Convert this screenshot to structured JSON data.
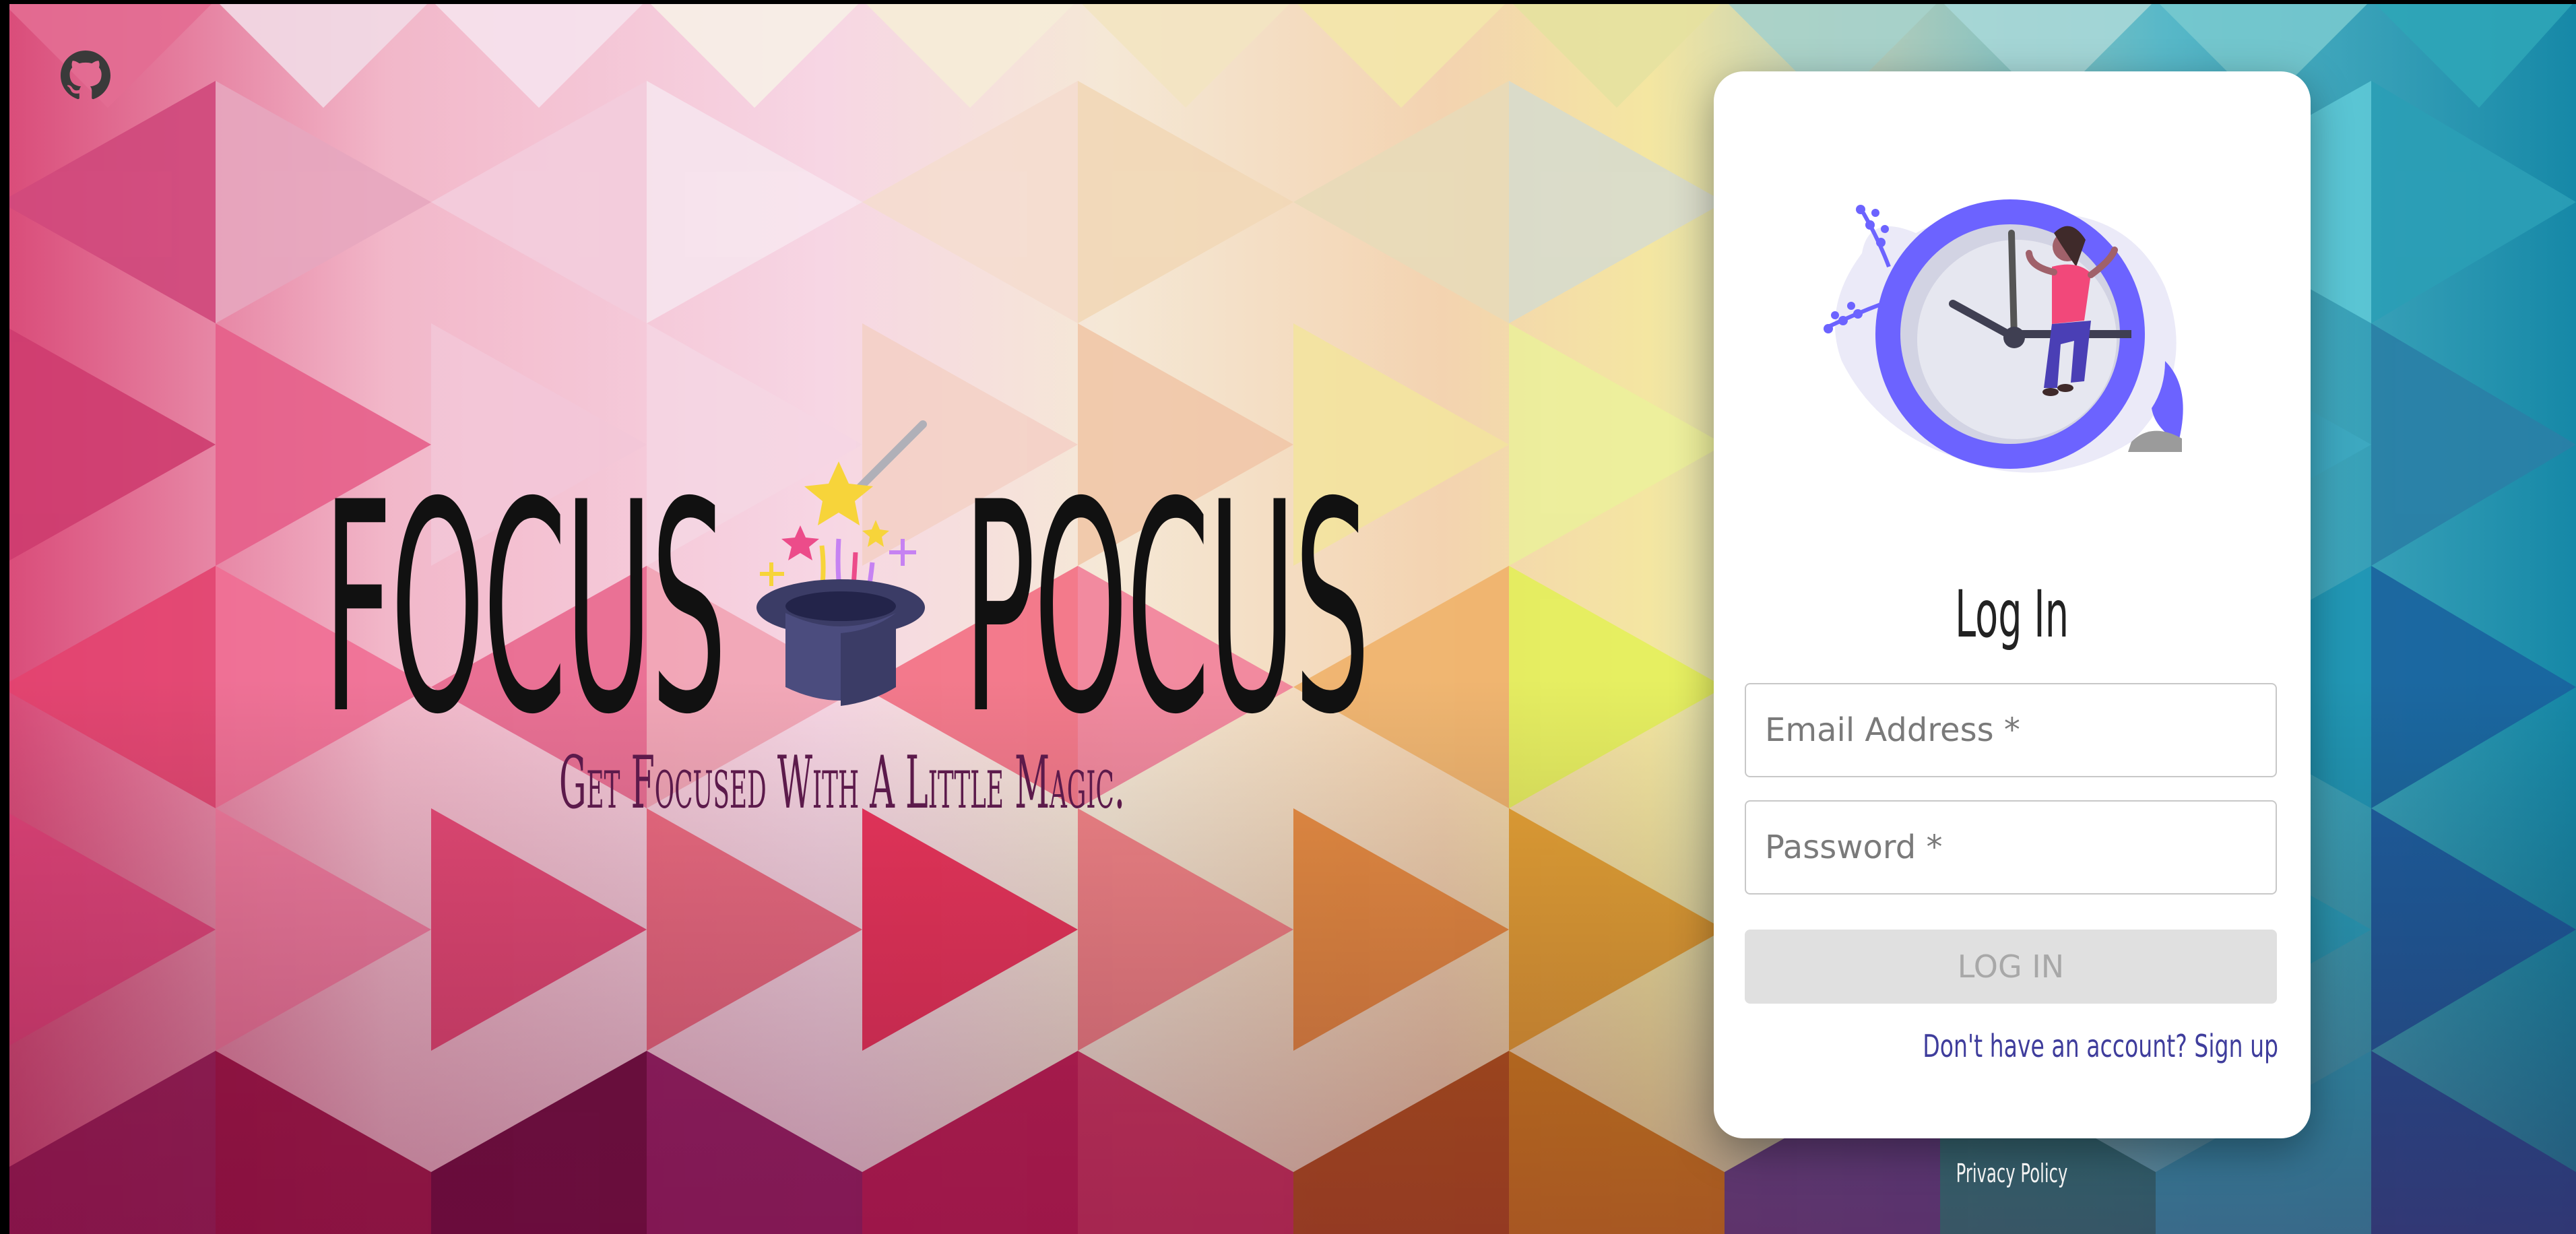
{
  "app": {
    "title_left": "FOCUS",
    "title_right": "POCUS",
    "tagline": "Get Focused With A Little Magic."
  },
  "icons": {
    "github": "github-icon",
    "hat": "magic-hat-icon",
    "clock": "clock-illustration"
  },
  "login": {
    "heading": "Log In",
    "email_placeholder": "Email Address *",
    "password_placeholder": "Password *",
    "button_label": "LOG IN",
    "signup_text": "Don't have an account? Sign up"
  },
  "footer": {
    "privacy": "Privacy Policy"
  },
  "colors": {
    "accent_purple": "#6c63ff",
    "link_blue": "#3f3d9c",
    "title_black": "#111111",
    "tagline_purple": "#5c1a4b",
    "disabled_button": "#e0e0e0"
  }
}
